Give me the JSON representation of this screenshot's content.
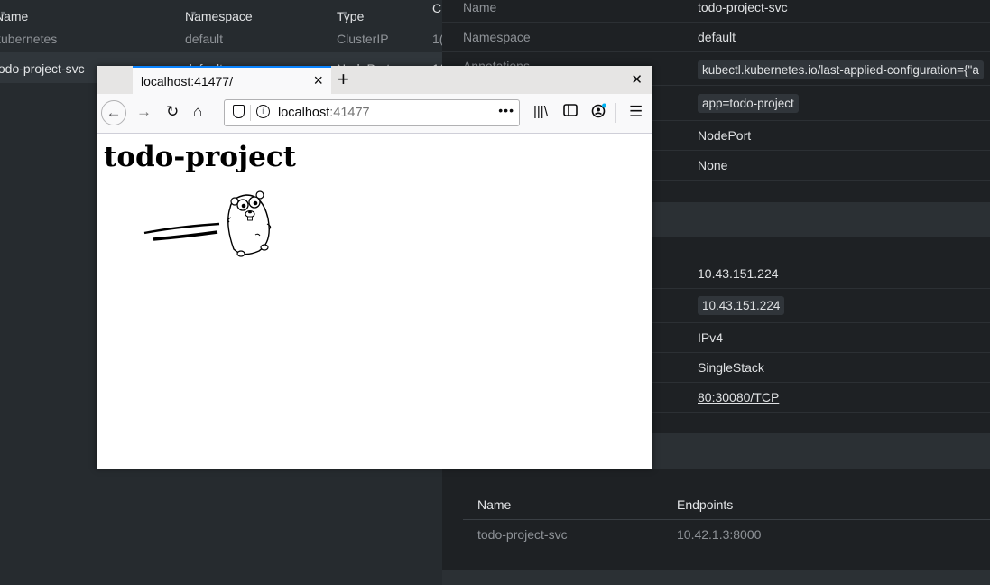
{
  "services_list": {
    "columns": [
      "Name",
      "Namespace",
      "Type",
      "C"
    ],
    "rows": [
      {
        "name": "kubernetes",
        "namespace": "default",
        "type": "ClusterIP",
        "cluster": "1("
      },
      {
        "name": "todo-project-svc",
        "namespace": "default",
        "type": "NodePort",
        "cluster": "1("
      }
    ]
  },
  "details": {
    "rows": [
      {
        "label": "Name",
        "value": "todo-project-svc"
      },
      {
        "label": "Namespace",
        "value": "default"
      },
      {
        "label": "Annotations",
        "value": "kubectl.kubernetes.io/last-applied-configuration={\"a"
      },
      {
        "label": "",
        "value": "app=todo-project"
      },
      {
        "label": "",
        "value": "NodePort"
      },
      {
        "label": "",
        "value": "None"
      },
      {
        "label": "",
        "value": "10.43.151.224"
      },
      {
        "label": "",
        "value": "10.43.151.224"
      },
      {
        "label": "",
        "value": "IPv4"
      },
      {
        "label": "",
        "value": "SingleStack"
      },
      {
        "label": "",
        "value": "80:30080/TCP"
      }
    ],
    "endpoints": {
      "headers": [
        "Name",
        "Endpoints"
      ],
      "rows": [
        {
          "name": "todo-project-svc",
          "endpoints": "10.42.1.3:8000"
        }
      ]
    }
  },
  "browser": {
    "tab_title": "localhost:41477/",
    "url_host": "localhost",
    "url_port": ":41477",
    "page_heading": "todo-project",
    "accent_color": "#0a84ff"
  },
  "icons": [
    "back-icon",
    "forward-icon",
    "reload-icon",
    "home-icon",
    "shield-icon",
    "info-icon",
    "library-icon",
    "sidebar-icon",
    "account-icon",
    "menu-icon",
    "close-icon",
    "new-tab-icon"
  ]
}
